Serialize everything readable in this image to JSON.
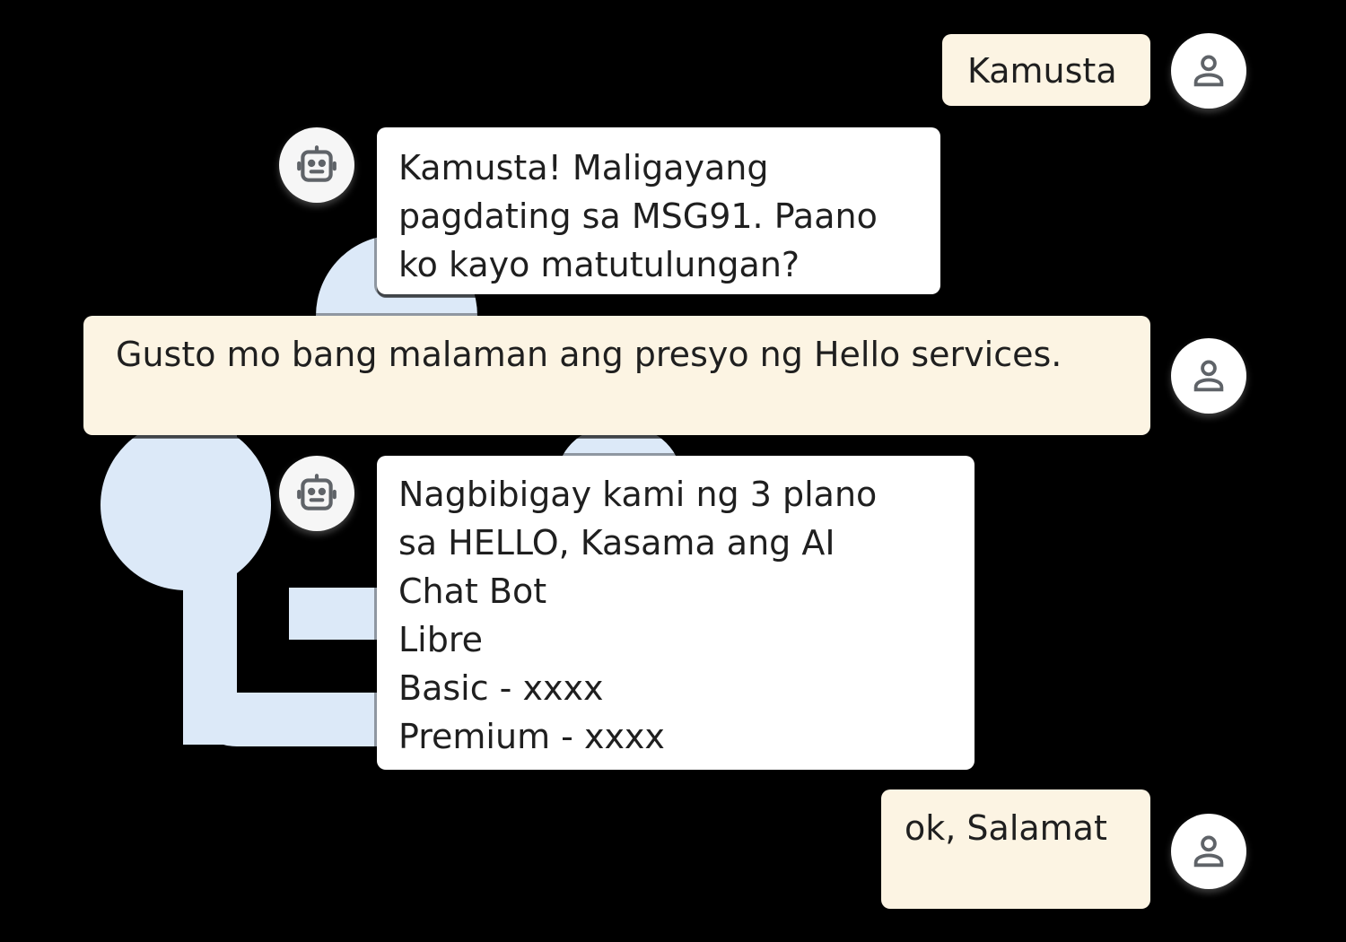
{
  "colors": {
    "user_bubble": "#fcf4e3",
    "bot_bubble": "#ffffff",
    "backdrop_shape": "#dce9f8",
    "icon": "#5f6368"
  },
  "conversation": {
    "messages": [
      {
        "sender": "user",
        "avatar_icon": "person-icon",
        "lines": [
          "Kamusta"
        ]
      },
      {
        "sender": "bot",
        "avatar_icon": "robot-icon",
        "lines": [
          "Kamusta! Maligayang",
          "pagdating sa MSG91. Paano",
          "ko kayo matutulungan?"
        ]
      },
      {
        "sender": "user",
        "avatar_icon": "person-icon",
        "lines": [
          "Gusto mo bang malaman ang presyo ng Hello services."
        ]
      },
      {
        "sender": "bot",
        "avatar_icon": "robot-icon",
        "lines": [
          "Nagbibigay kami ng 3 plano",
          "sa HELLO, Kasama ang AI",
          "Chat Bot",
          "Libre",
          "Basic - xxxx",
          "Premium - xxxx"
        ]
      },
      {
        "sender": "user",
        "avatar_icon": "person-icon",
        "lines": [
          "ok, Salamat"
        ]
      }
    ]
  }
}
